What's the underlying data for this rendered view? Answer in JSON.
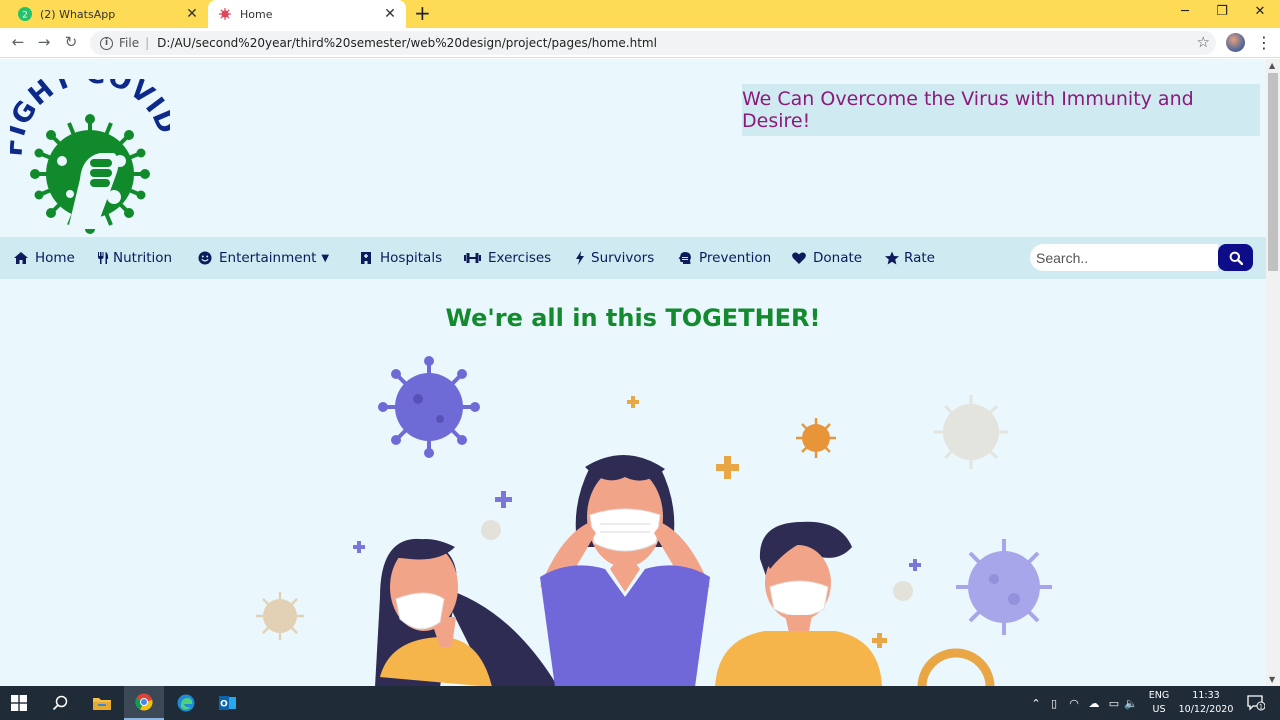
{
  "browser": {
    "tabs": [
      {
        "label": "(2) WhatsApp",
        "badge": "2",
        "active": false
      },
      {
        "label": "Home",
        "active": true
      }
    ],
    "address": {
      "scheme_label": "File",
      "url": "D:/AU/second%20year/third%20semester/web%20design/project/pages/home.html"
    }
  },
  "page": {
    "slogan": "We Can Overcome the Virus with Immunity and Desire!",
    "logo_text": "FIGHT COVID",
    "nav": [
      {
        "label": "Home",
        "icon": "home-icon"
      },
      {
        "label": "Nutrition",
        "icon": "cutlery-icon"
      },
      {
        "label": "Entertainment",
        "icon": "smile-icon",
        "dropdown": true
      },
      {
        "label": "Hospitals",
        "icon": "hospital-icon"
      },
      {
        "label": "Exercises",
        "icon": "dumbbell-icon"
      },
      {
        "label": "Survivors",
        "icon": "bolt-icon"
      },
      {
        "label": "Prevention",
        "icon": "head-mask-icon"
      },
      {
        "label": "Donate",
        "icon": "heart-icon"
      },
      {
        "label": "Rate",
        "icon": "star-icon"
      }
    ],
    "search": {
      "placeholder": "Search..",
      "value": ""
    },
    "headline": "We're all in this TOGETHER!"
  },
  "taskbar": {
    "language": "ENG",
    "region": "US",
    "time": "11:33",
    "date": "10/12/2020",
    "notifications": "1"
  },
  "colors": {
    "tabbar": "#fddb55",
    "page_background": "#eaf7fd",
    "menubar": "#cfeaf0",
    "nav_text": "#0d1a5c",
    "slogan_text": "#8b1a7a",
    "headline": "#138a2e",
    "search_button": "#0d0d8a",
    "taskbar": "#1f2b36"
  }
}
